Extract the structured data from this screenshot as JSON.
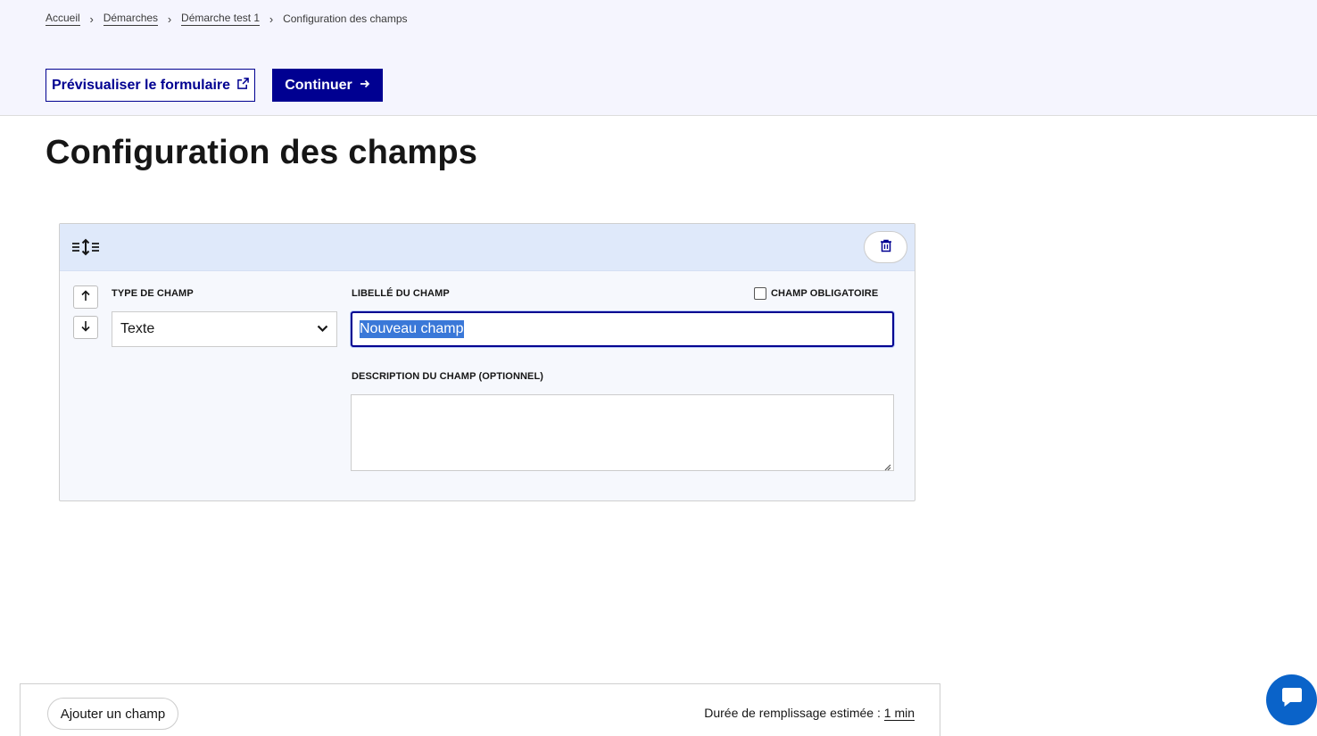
{
  "breadcrumb": {
    "items": [
      "Accueil",
      "Démarches",
      "Démarche test 1"
    ],
    "current": "Configuration des champs",
    "separator": "›"
  },
  "actions": {
    "preview_label": "Prévisualiser le formulaire",
    "continue_label": "Continuer"
  },
  "page_title": "Configuration des champs",
  "field_card": {
    "type_label": "TYPE DE CHAMP",
    "type_value": "Texte",
    "libelle_label": "LIBELLÉ DU CHAMP",
    "libelle_value": "Nouveau champ",
    "required_label": "CHAMP OBLIGATOIRE",
    "required_checked": false,
    "description_label": "DESCRIPTION DU CHAMP (OPTIONNEL)",
    "description_value": ""
  },
  "footer": {
    "add_label": "Ajouter un champ",
    "duration_prefix": "Durée de remplissage estimée : ",
    "duration_value": "1 min"
  },
  "colors": {
    "primary": "#000091",
    "header_band": "#f5f5fe",
    "card_header": "#dfe9fa",
    "chat_button": "#0a63c9"
  }
}
